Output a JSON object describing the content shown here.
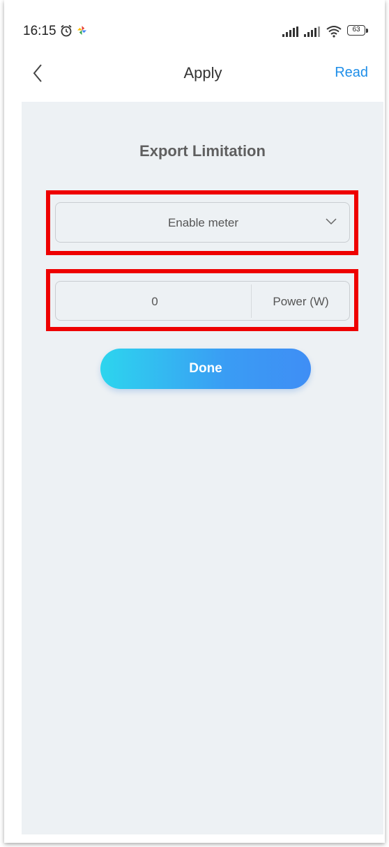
{
  "status_bar": {
    "time": "16:15",
    "battery_level": "63",
    "icons": [
      "alarm-icon",
      "pinwheel-icon",
      "signal-icon",
      "signal-icon",
      "wifi-icon",
      "battery-icon"
    ]
  },
  "header": {
    "back_icon": "chevron-left-icon",
    "title": "Apply",
    "read_label": "Read"
  },
  "main": {
    "section_title": "Export Limitation",
    "meter_select": {
      "selected": "Enable meter",
      "icon": "chevron-down-icon"
    },
    "power_input": {
      "value": "0",
      "unit_label": "Power (W)"
    },
    "done_label": "Done"
  },
  "colors": {
    "accent": "#1e8ee8",
    "highlight": "#ee0000",
    "background": "#edf1f4",
    "button_gradient_start": "#2dd5ee",
    "button_gradient_end": "#3f8ef5"
  }
}
